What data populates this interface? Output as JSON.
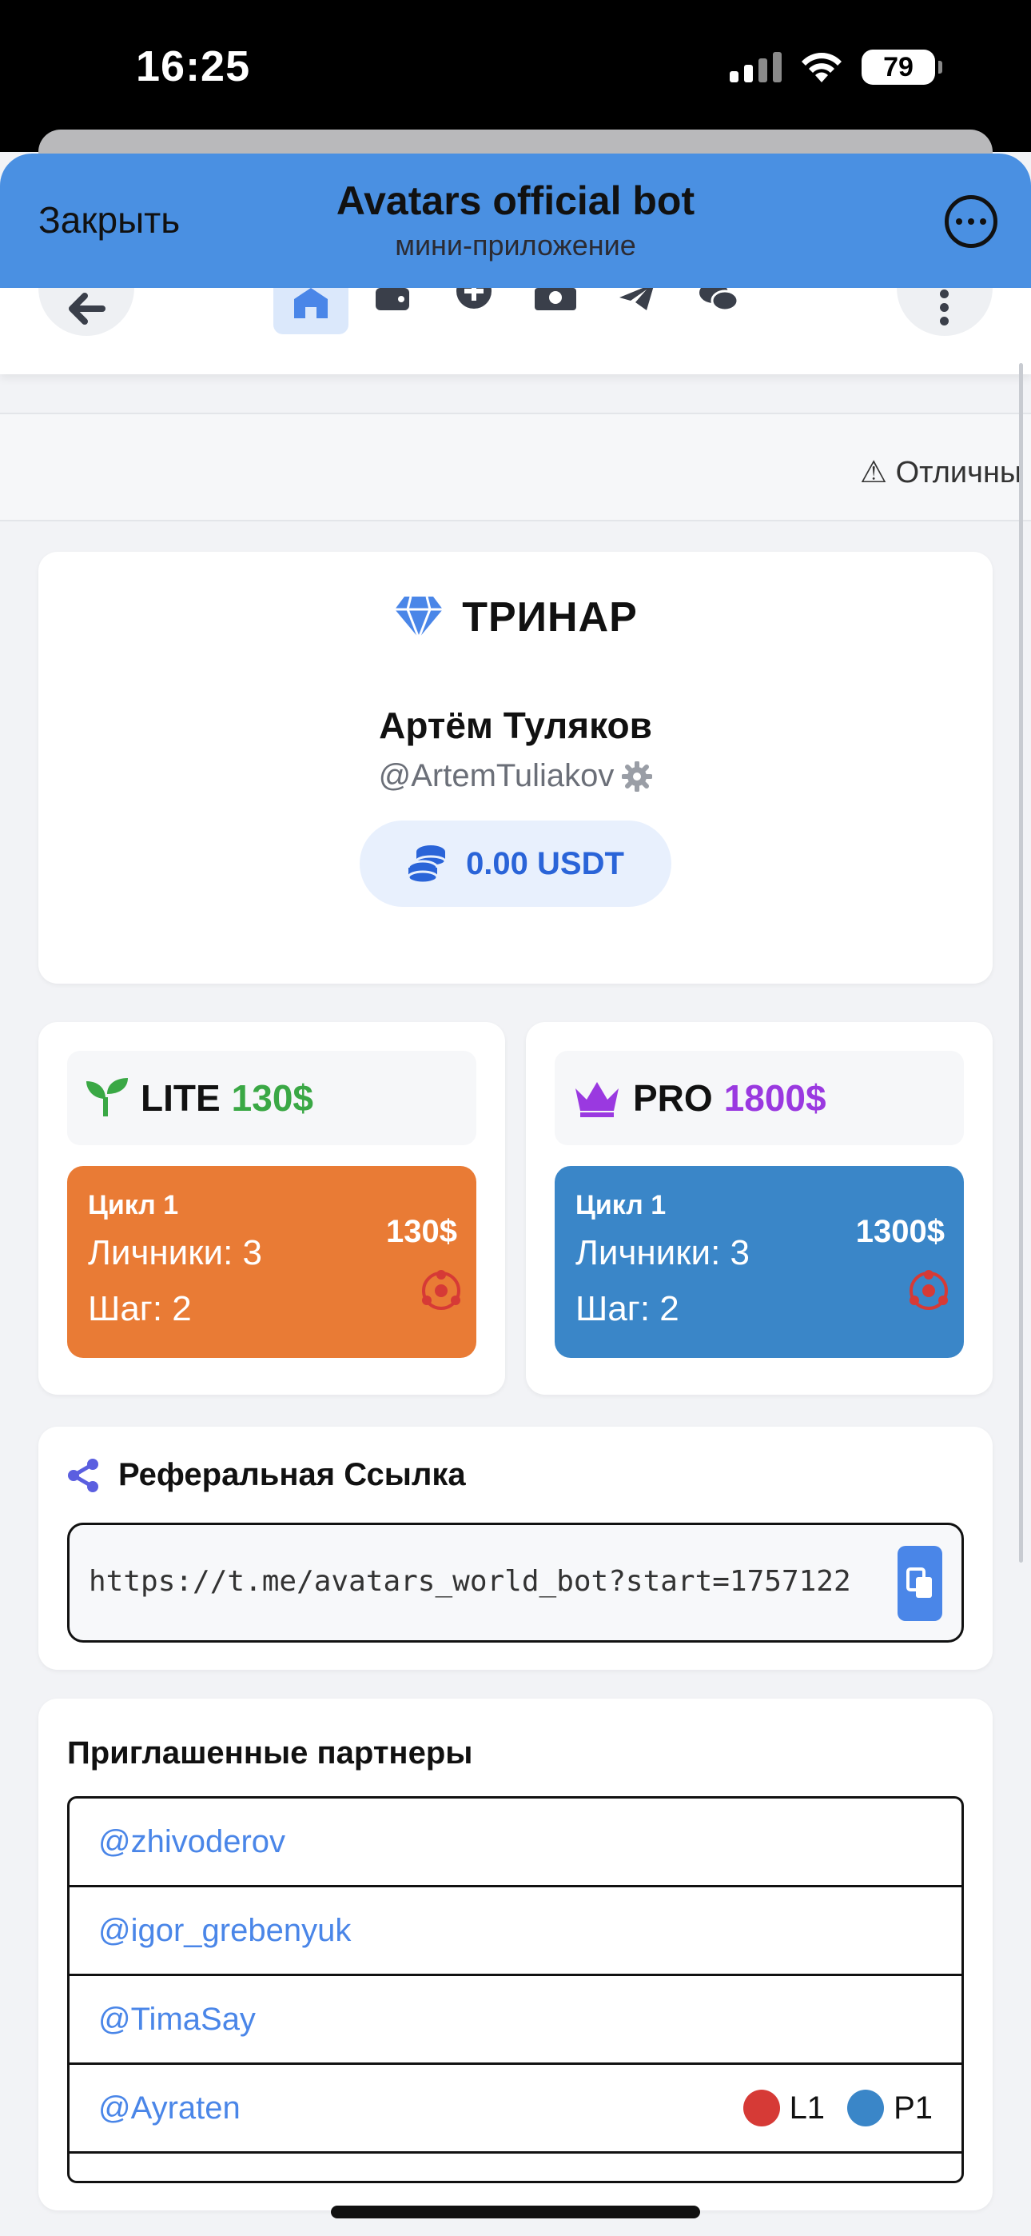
{
  "status_bar": {
    "time": "16:25",
    "battery": "79"
  },
  "tg_header": {
    "close_label": "Закрыть",
    "title": "Avatars official bot",
    "subtitle": "мини-приложение"
  },
  "ticker": {
    "text": "⚠ Отличны"
  },
  "profile": {
    "brand": "ТРИНАР",
    "name": "Артём Туляков",
    "handle": "@ArtemTuliakov",
    "balance": "0.00 USDT"
  },
  "plans": [
    {
      "name": "LITE",
      "price": "130$",
      "price_color": "#3aa845",
      "box_color": "#e97b35",
      "cycle": "Цикл 1",
      "line1": "Личники: 3",
      "line2": "Шаг: 2",
      "amount": "130$"
    },
    {
      "name": "PRO",
      "price": "1800$",
      "price_color": "#9a39e0",
      "box_color": "#3a86c8",
      "cycle": "Цикл 1",
      "line1": "Личники: 3",
      "line2": "Шаг: 2",
      "amount": "1300$"
    }
  ],
  "referral": {
    "title": "Реферальная Ссылка",
    "link": "https://t.me/avatars_world_bot?start=1757122"
  },
  "partners": {
    "title": "Приглашенные партнеры",
    "rows": [
      {
        "handle": "@zhivoderov"
      },
      {
        "handle": "@igor_grebenyuk"
      },
      {
        "handle": "@TimaSay"
      },
      {
        "handle": "@Ayraten",
        "tag1": "L1",
        "tag2": "P1"
      }
    ]
  },
  "colors": {
    "telegram_header": "#4a90e2",
    "accent": "#2a64d8",
    "link": "#4a86e8"
  }
}
